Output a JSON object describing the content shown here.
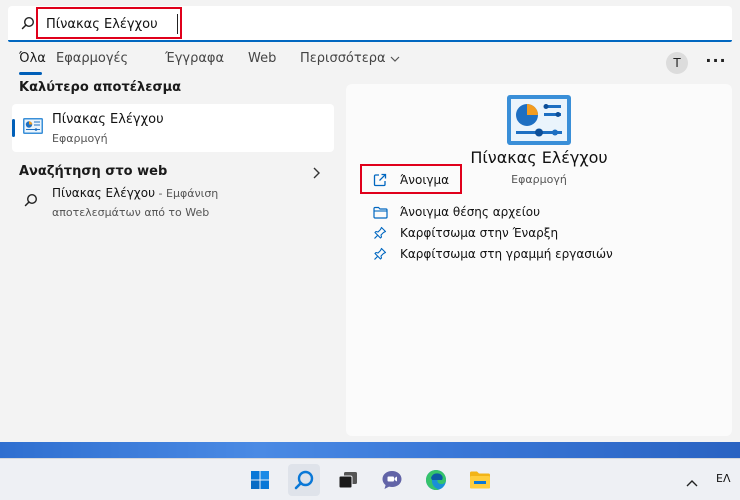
{
  "search": {
    "query": "Πίνακας Ελέγχου"
  },
  "tabs": [
    {
      "label": "Όλα"
    },
    {
      "label": "Εφαρμογές"
    },
    {
      "label": "Έγγραφα"
    },
    {
      "label": "Web"
    },
    {
      "label": "Περισσότερα"
    }
  ],
  "user": {
    "avatar_letter": "T"
  },
  "best_match": {
    "header": "Καλύτερο αποτέλεσμα",
    "title": "Πίνακας Ελέγχου",
    "subtitle": "Εφαρμογή",
    "icon": "control-panel-icon"
  },
  "web_search": {
    "header": "Αναζήτηση στο web",
    "item_title": "Πίνακας Ελέγχου",
    "item_suffix": " - Εμφάνιση",
    "item_line2": "αποτελεσμάτων από το Web"
  },
  "detail": {
    "title": "Πίνακας Ελέγχου",
    "subtitle": "Εφαρμογή",
    "actions": [
      {
        "label": "Άνοιγμα",
        "icon": "open-external-icon"
      },
      {
        "label": "Άνοιγμα θέσης αρχείου",
        "icon": "folder-icon"
      },
      {
        "label": "Καρφίτσωμα στην Έναρξη",
        "icon": "pin-icon"
      },
      {
        "label": "Καρφίτσωμα στη γραμμή εργασιών",
        "icon": "pin-icon"
      }
    ]
  },
  "taskbar": {
    "apps": [
      "windows-start-icon",
      "search-icon",
      "task-view-icon",
      "teams-chat-icon",
      "edge-icon",
      "file-explorer-icon"
    ],
    "language": "ΕΛ"
  },
  "colors": {
    "accent": "#005fb8",
    "highlight_red": "#e0001b"
  }
}
